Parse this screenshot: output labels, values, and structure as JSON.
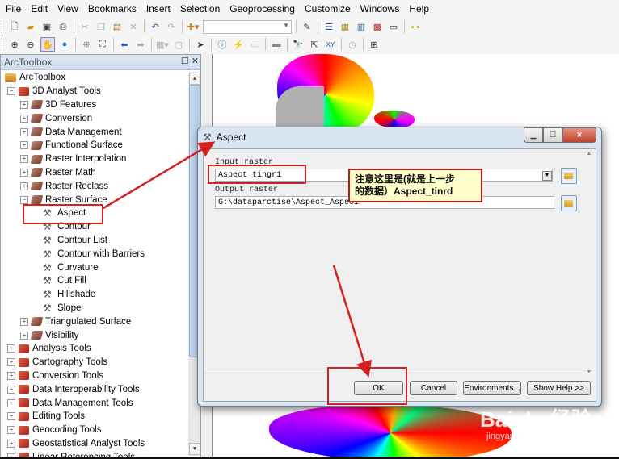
{
  "menu": [
    "File",
    "Edit",
    "View",
    "Bookmarks",
    "Insert",
    "Selection",
    "Geoprocessing",
    "Customize",
    "Windows",
    "Help"
  ],
  "toolbar1": {
    "icons": [
      "new-document-icon",
      "open-folder-icon",
      "save-icon",
      "print-icon",
      "cut-icon",
      "copy-icon",
      "paste-icon",
      "delete-icon",
      "undo-icon",
      "redo-icon",
      "add-data-icon"
    ],
    "scale_combo_value": "",
    "icons_right": [
      "editor-icon",
      "table-of-contents-icon",
      "catalog-icon",
      "search-window-icon",
      "arctoolbox-icon",
      "python-window-icon",
      "model-builder-icon"
    ]
  },
  "toolbar2": {
    "icons": [
      "zoom-in-icon",
      "zoom-out-icon",
      "pan-icon",
      "full-extent-icon",
      "fixed-zoom-in-icon",
      "fixed-zoom-out-icon",
      "back-icon",
      "forward-icon",
      "select-features-icon",
      "clear-selection-icon",
      "select-elements-icon",
      "identify-icon",
      "hyperlink-icon",
      "html-popup-icon",
      "measure-icon",
      "find-icon",
      "route-icon",
      "goto-xy-icon",
      "time-slider-icon",
      "create-viewer-icon"
    ]
  },
  "toolbox": {
    "title": "ArcToolbox",
    "root": "ArcToolbox",
    "items": [
      {
        "label": "3D Analyst Tools",
        "level": 1,
        "type": "toolbox",
        "expanded": true
      },
      {
        "label": "3D Features",
        "level": 2,
        "type": "toolset",
        "expanded": false
      },
      {
        "label": "Conversion",
        "level": 2,
        "type": "toolset",
        "expanded": false
      },
      {
        "label": "Data Management",
        "level": 2,
        "type": "toolset",
        "expanded": false
      },
      {
        "label": "Functional Surface",
        "level": 2,
        "type": "toolset",
        "expanded": false
      },
      {
        "label": "Raster Interpolation",
        "level": 2,
        "type": "toolset",
        "expanded": false
      },
      {
        "label": "Raster Math",
        "level": 2,
        "type": "toolset",
        "expanded": false
      },
      {
        "label": "Raster Reclass",
        "level": 2,
        "type": "toolset",
        "expanded": false
      },
      {
        "label": "Raster Surface",
        "level": 2,
        "type": "toolset",
        "expanded": true
      },
      {
        "label": "Aspect",
        "level": 3,
        "type": "tool"
      },
      {
        "label": "Contour",
        "level": 3,
        "type": "tool"
      },
      {
        "label": "Contour List",
        "level": 3,
        "type": "tool"
      },
      {
        "label": "Contour with Barriers",
        "level": 3,
        "type": "tool"
      },
      {
        "label": "Curvature",
        "level": 3,
        "type": "tool"
      },
      {
        "label": "Cut Fill",
        "level": 3,
        "type": "tool"
      },
      {
        "label": "Hillshade",
        "level": 3,
        "type": "tool"
      },
      {
        "label": "Slope",
        "level": 3,
        "type": "tool"
      },
      {
        "label": "Triangulated Surface",
        "level": 2,
        "type": "toolset",
        "expanded": false
      },
      {
        "label": "Visibility",
        "level": 2,
        "type": "toolset",
        "expanded": false
      },
      {
        "label": "Analysis Tools",
        "level": 1,
        "type": "toolbox",
        "expanded": false
      },
      {
        "label": "Cartography Tools",
        "level": 1,
        "type": "toolbox",
        "expanded": false
      },
      {
        "label": "Conversion Tools",
        "level": 1,
        "type": "toolbox",
        "expanded": false
      },
      {
        "label": "Data Interoperability Tools",
        "level": 1,
        "type": "toolbox",
        "expanded": false
      },
      {
        "label": "Data Management Tools",
        "level": 1,
        "type": "toolbox",
        "expanded": false
      },
      {
        "label": "Editing Tools",
        "level": 1,
        "type": "toolbox",
        "expanded": false
      },
      {
        "label": "Geocoding Tools",
        "level": 1,
        "type": "toolbox",
        "expanded": false
      },
      {
        "label": "Geostatistical Analyst Tools",
        "level": 1,
        "type": "toolbox",
        "expanded": false
      },
      {
        "label": "Linear Referencing Tools",
        "level": 1,
        "type": "toolbox",
        "expanded": false
      }
    ]
  },
  "dialog": {
    "title": "Aspect",
    "input_label": "Input raster",
    "input_value": "Aspect_tingr1",
    "output_label": "Output raster",
    "output_value": "G:\\dataparctise\\Aspect_Aspec1",
    "buttons": {
      "ok": "OK",
      "cancel": "Cancel",
      "environments": "Environments...",
      "show_help": "Show Help >>"
    }
  },
  "annotation": {
    "callout_line1": "注意这里是(就是上一步",
    "callout_line2": "的数据）Aspect_tinrd",
    "accent_color": "#d42020"
  },
  "watermark": {
    "main": "Bai du 经验",
    "sub": "jingyan.baidu.com"
  }
}
